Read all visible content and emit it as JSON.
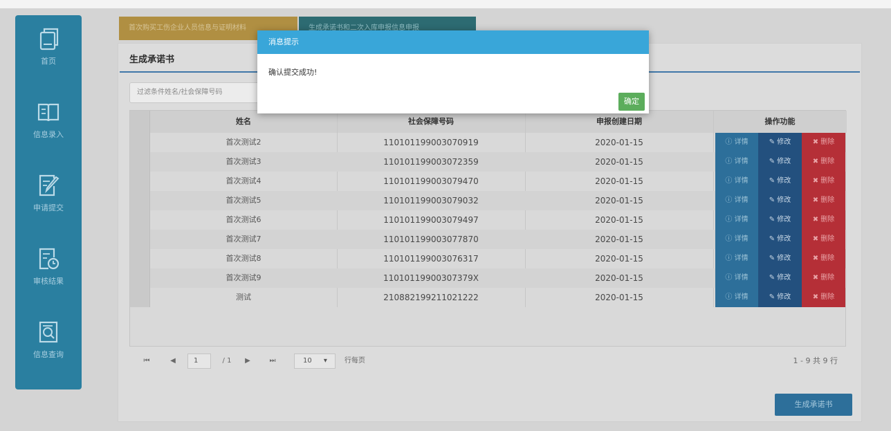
{
  "sidebar": {
    "items": [
      {
        "label": "首页",
        "icon": "copy-pages-icon"
      },
      {
        "label": "信息录入",
        "icon": "open-book-icon"
      },
      {
        "label": "申请提交",
        "icon": "edit-document-icon"
      },
      {
        "label": "审核结果",
        "icon": "document-clock-icon"
      },
      {
        "label": "信息查询",
        "icon": "document-search-icon"
      }
    ]
  },
  "tabs": [
    {
      "label": "首次购买工伤企业人员信息与证明材料"
    },
    {
      "label": "生成承诺书和二次入库申报信息申报"
    }
  ],
  "panel": {
    "title": "生成承诺书",
    "search_placeholder": "过滤条件姓名/社会保障号码"
  },
  "table": {
    "headers": {
      "name": "姓名",
      "id": "社会保障号码",
      "date": "申报创建日期",
      "actions": "操作功能"
    },
    "action_labels": {
      "detail": "详情",
      "edit": "修改",
      "delete": "删除"
    },
    "rows": [
      {
        "name": "首次测试2",
        "id": "110101199003070919",
        "date": "2020-01-15"
      },
      {
        "name": "首次测试3",
        "id": "110101199003072359",
        "date": "2020-01-15"
      },
      {
        "name": "首次测试4",
        "id": "110101199003079470",
        "date": "2020-01-15"
      },
      {
        "name": "首次测试5",
        "id": "110101199003079032",
        "date": "2020-01-15"
      },
      {
        "name": "首次测试6",
        "id": "110101199003079497",
        "date": "2020-01-15"
      },
      {
        "name": "首次测试7",
        "id": "110101199003077870",
        "date": "2020-01-15"
      },
      {
        "name": "首次测试8",
        "id": "110101199003076317",
        "date": "2020-01-15"
      },
      {
        "name": "首次测试9",
        "id": "11010119900307379X",
        "date": "2020-01-15"
      },
      {
        "name": "测试",
        "id": "210882199211021222",
        "date": "2020-01-15"
      }
    ]
  },
  "pager": {
    "first": "⏮",
    "prev": "◀",
    "page": "1",
    "of_total": "/ 1",
    "next": "▶",
    "last": "⏭",
    "page_size": "10",
    "per_page_label": "行每页",
    "summary": "1 - 9 共 9 行"
  },
  "generate_button": "生成承诺书",
  "modal": {
    "title": "消息提示",
    "message": "确认提交成功!",
    "ok_label": "确定"
  },
  "colors": {
    "sidebar": "#2a7fa0",
    "modal_header": "#39a6d9",
    "ok_button": "#5cad5c",
    "detail": "#2d6f9a",
    "edit": "#23507e",
    "delete": "#b52f37"
  }
}
